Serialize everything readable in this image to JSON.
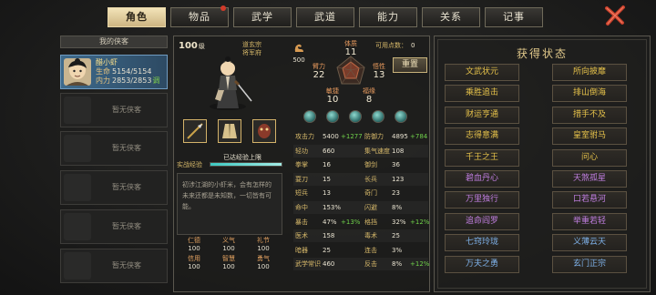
{
  "tabs": [
    {
      "label": "角色",
      "active": true
    },
    {
      "label": "物品",
      "dot": true
    },
    {
      "label": "武学"
    },
    {
      "label": "武道"
    },
    {
      "label": "能力"
    },
    {
      "label": "关系"
    },
    {
      "label": "记事"
    }
  ],
  "left": {
    "header": "我的侠客",
    "selected": {
      "name": "醋小虾",
      "hp_label": "生命",
      "hp": "5154/5154",
      "mp_label": "内力",
      "mp": "2853/2853",
      "mp_tail": "调"
    },
    "empty_label": "暂无侠客"
  },
  "character": {
    "level": "100",
    "level_unit": "级",
    "titles": [
      "道玄宗",
      "将军府"
    ],
    "attack_bonus": "500",
    "radar": {
      "体质": "11",
      "臂力": "22",
      "悟性": "13",
      "敏捷": "10",
      "福缘": "8"
    },
    "free_points_label": "可用点数：",
    "free_points": "0",
    "reset_label": "重置",
    "exp_label": "实战经验",
    "exp_max_label": "已达经验上限",
    "exp_progress": 1.0,
    "bio": "初涉江湖的小虾米，会有怎样的未来还都是未知数，一切皆有可能。",
    "virtues": [
      {
        "k": "仁德",
        "v": "100"
      },
      {
        "k": "义气",
        "v": "100"
      },
      {
        "k": "礼节",
        "v": "100"
      },
      {
        "k": "信用",
        "v": "100"
      },
      {
        "k": "智慧",
        "v": "100"
      },
      {
        "k": "勇气",
        "v": "100"
      }
    ],
    "stats": [
      [
        {
          "k": "攻击力",
          "v": "5400",
          "b": "+1277"
        },
        {
          "k": "防御力",
          "v": "4895",
          "b": "+784"
        }
      ],
      [
        {
          "k": "轻功",
          "v": "660",
          "b": ""
        },
        {
          "k": "集气速度",
          "v": "108",
          "b": ""
        }
      ],
      [
        {
          "k": "拳掌",
          "v": "16",
          "b": ""
        },
        {
          "k": "御剑",
          "v": "36",
          "b": ""
        }
      ],
      [
        {
          "k": "耍刀",
          "v": "15",
          "b": ""
        },
        {
          "k": "长兵",
          "v": "123",
          "b": ""
        }
      ],
      [
        {
          "k": "短兵",
          "v": "13",
          "b": ""
        },
        {
          "k": "奇门",
          "v": "23",
          "b": ""
        }
      ],
      [
        {
          "k": "命中",
          "v": "153%",
          "b": ""
        },
        {
          "k": "闪避",
          "v": "8%",
          "b": ""
        }
      ],
      [
        {
          "k": "暴击",
          "v": "47%",
          "b": "+13%"
        },
        {
          "k": "格挡",
          "v": "32%",
          "b": "+12%"
        }
      ],
      [
        {
          "k": "医术",
          "v": "158",
          "b": ""
        },
        {
          "k": "毒术",
          "v": "25",
          "b": ""
        }
      ],
      [
        {
          "k": "暗器",
          "v": "25",
          "b": ""
        },
        {
          "k": "连击",
          "v": "3%",
          "b": ""
        }
      ],
      [
        {
          "k": "武学常识",
          "v": "460",
          "b": ""
        },
        {
          "k": "反击",
          "v": "8%",
          "b": "+12%"
        }
      ]
    ]
  },
  "states": {
    "title": "获得状态",
    "items": [
      {
        "label": "文武状元",
        "color": "#e6c24a"
      },
      {
        "label": "所向披靡",
        "color": "#e6c24a"
      },
      {
        "label": "乘胜追击",
        "color": "#e6c24a"
      },
      {
        "label": "排山倒海",
        "color": "#e6c24a"
      },
      {
        "label": "财运亨通",
        "color": "#e6c24a"
      },
      {
        "label": "措手不及",
        "color": "#e6c24a"
      },
      {
        "label": "志得意满",
        "color": "#e6c24a"
      },
      {
        "label": "皇室驸马",
        "color": "#e6c24a"
      },
      {
        "label": "千王之王",
        "color": "#e6c24a"
      },
      {
        "label": "问心",
        "color": "#e6c24a"
      },
      {
        "label": "碧血丹心",
        "color": "#c07ee0"
      },
      {
        "label": "天煞孤星",
        "color": "#c07ee0"
      },
      {
        "label": "万里独行",
        "color": "#c07ee0"
      },
      {
        "label": "口若悬河",
        "color": "#c07ee0"
      },
      {
        "label": "追命阎罗",
        "color": "#c07ee0"
      },
      {
        "label": "举重若轻",
        "color": "#c07ee0"
      },
      {
        "label": "七窍玲珑",
        "color": "#7fb2ea"
      },
      {
        "label": "义薄云天",
        "color": "#7fb2ea"
      },
      {
        "label": "万夫之勇",
        "color": "#7fb2ea"
      },
      {
        "label": "玄门正宗",
        "color": "#7fb2ea"
      }
    ]
  }
}
